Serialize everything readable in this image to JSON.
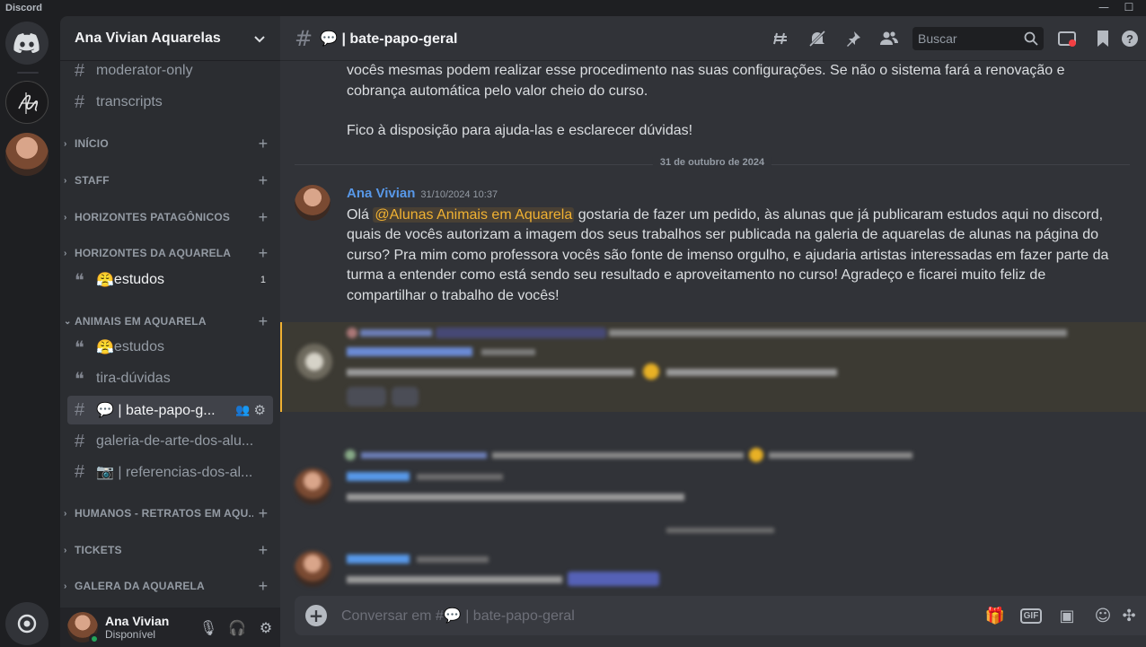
{
  "window": {
    "app_name": "Discord",
    "minimize": "—",
    "maximize": "☐"
  },
  "guild": {
    "name": "Ana Vivian Aquarelas"
  },
  "sidebar": {
    "channels_top": [
      {
        "label": "moderator-only"
      },
      {
        "label": "transcripts"
      }
    ],
    "categories": [
      {
        "label": "INÍCIO",
        "collapsed": true
      },
      {
        "label": "STAFF",
        "collapsed": true
      },
      {
        "label": "HORIZONTES PATAGÔNICOS",
        "collapsed": true
      },
      {
        "label": "HORIZONTES DA AQUARELA",
        "collapsed": true
      },
      {
        "label": "ANIMAIS EM AQUARELA",
        "collapsed": false
      },
      {
        "label": "HUMANOS - RETRATOS EM AQU...",
        "collapsed": true
      },
      {
        "label": "TICKETS",
        "collapsed": true
      },
      {
        "label": "GALERA DA AQUARELA",
        "collapsed": true
      }
    ],
    "horizontes_forum": {
      "label": "estudos",
      "emoji": "😤",
      "badge": "1"
    },
    "animais_channels": [
      {
        "label": "estudos",
        "emoji": "😤",
        "kind": "forum"
      },
      {
        "label": "tira-dúvidas",
        "kind": "forum"
      },
      {
        "label": "💬 | bate-papo-g...",
        "kind": "text",
        "active": true
      },
      {
        "label": "galeria-de-arte-dos-alu...",
        "kind": "text"
      },
      {
        "label": "📷 | referencias-dos-al...",
        "kind": "text"
      }
    ]
  },
  "user": {
    "name": "Ana Vivian",
    "status": "Disponível"
  },
  "channel": {
    "title": "💬 | bate-papo-geral",
    "search_placeholder": "Buscar",
    "composer_placeholder": "Conversar em #💬 | bate-papo-geral"
  },
  "messages": {
    "continuation_1": "vocês mesmas podem realizar esse procedimento nas suas configurações. Se não o sistema fará a renovação e cobrança automática pelo valor cheio do curso.",
    "continuation_2": "Fico à disposição para ajuda-las e esclarecer dúvidas!",
    "date_divider": "31 de outubro de 2024",
    "main": {
      "author": "Ana Vivian",
      "timestamp": "31/10/2024 10:37",
      "prefix": "Olá ",
      "mention": "@Alunas Animais em Aquarela",
      "text": " gostaria de fazer um pedido, às alunas que já publicaram estudos aqui no discord, quais de vocês autorizam a imagem dos seus trabalhos ser publicada na galeria de aquarelas de alunas na página do curso? Pra mim como professora vocês são fonte de imenso orgulho, e ajudaria artistas interessadas em fazer parte da turma a entender como está sendo seu resultado e aproveitamento no curso! Agradeço e ficarei muito feliz de compartilhar o trabalho de vocês!"
    }
  },
  "colors": {
    "accent_author": "#5898e8",
    "mention": "#f0b132",
    "online": "#23a55a"
  }
}
